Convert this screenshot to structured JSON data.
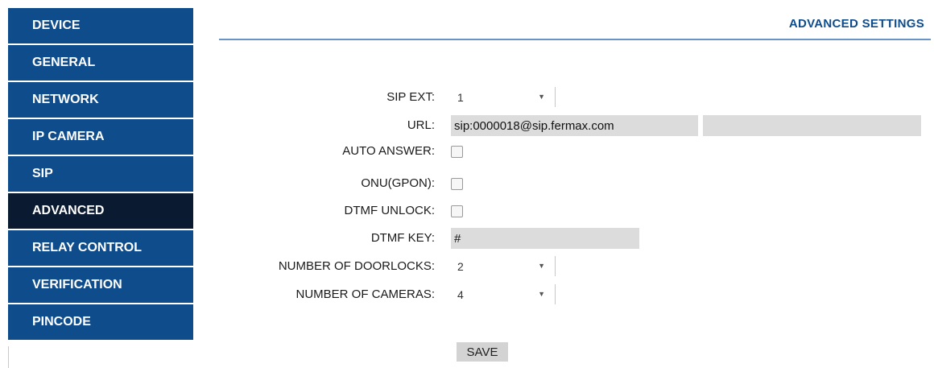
{
  "sidebar": {
    "items": [
      {
        "label": "DEVICE"
      },
      {
        "label": "GENERAL"
      },
      {
        "label": "NETWORK"
      },
      {
        "label": "IP CAMERA"
      },
      {
        "label": "SIP"
      },
      {
        "label": "ADVANCED",
        "active": true
      },
      {
        "label": "RELAY CONTROL"
      },
      {
        "label": "VERIFICATION"
      },
      {
        "label": "PINCODE"
      }
    ]
  },
  "header": {
    "title": "ADVANCED SETTINGS"
  },
  "form": {
    "sip_ext": {
      "label": "SIP EXT:",
      "value": "1"
    },
    "url": {
      "label": "URL:",
      "value": "sip:0000018@sip.fermax.com"
    },
    "auto_answer": {
      "label": "AUTO ANSWER:",
      "checked": false
    },
    "onu_gpon": {
      "label": "ONU(GPON):",
      "checked": false
    },
    "dtmf_unlock": {
      "label": "DTMF UNLOCK:",
      "checked": false
    },
    "dtmf_key": {
      "label": "DTMF KEY:",
      "value": "#"
    },
    "door_locks": {
      "label": "NUMBER OF DOORLOCKS:",
      "value": "2"
    },
    "cameras": {
      "label": "NUMBER OF CAMERAS:",
      "value": "4"
    }
  },
  "save_label": "SAVE",
  "colors": {
    "nav_bg": "#0e4c8c",
    "nav_active_bg": "#0a1a30",
    "title_color": "#0e4c8c",
    "field_bg": "#dcdcdc"
  }
}
